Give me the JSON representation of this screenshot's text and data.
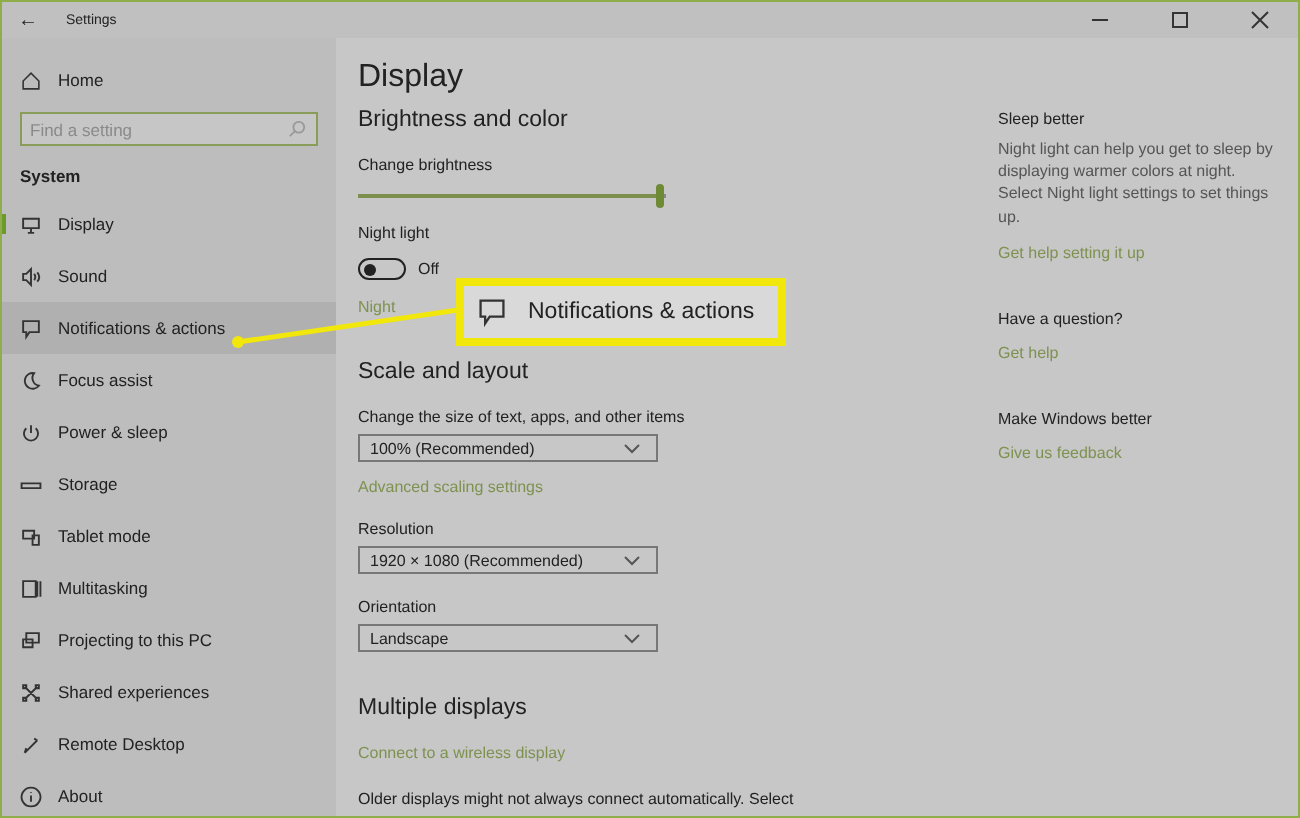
{
  "window": {
    "title": "Settings",
    "back": "←"
  },
  "sidebar": {
    "home": "Home",
    "search": {
      "placeholder": "Find a setting"
    },
    "section": "System",
    "items": [
      {
        "label": "Display",
        "selected": true,
        "highlighted": false
      },
      {
        "label": "Sound",
        "selected": false,
        "highlighted": false
      },
      {
        "label": "Notifications & actions",
        "selected": false,
        "highlighted": true
      },
      {
        "label": "Focus assist",
        "selected": false,
        "highlighted": false
      },
      {
        "label": "Power & sleep",
        "selected": false,
        "highlighted": false
      },
      {
        "label": "Storage",
        "selected": false,
        "highlighted": false
      },
      {
        "label": "Tablet mode",
        "selected": false,
        "highlighted": false
      },
      {
        "label": "Multitasking",
        "selected": false,
        "highlighted": false
      },
      {
        "label": "Projecting to this PC",
        "selected": false,
        "highlighted": false
      },
      {
        "label": "Shared experiences",
        "selected": false,
        "highlighted": false
      },
      {
        "label": "Remote Desktop",
        "selected": false,
        "highlighted": false
      },
      {
        "label": "About",
        "selected": false,
        "highlighted": false
      }
    ]
  },
  "main": {
    "title": "Display",
    "brightness_heading": "Brightness and color",
    "brightness": {
      "label": "Change brightness",
      "level": 0.98
    },
    "night_light": {
      "label": "Night light",
      "on": false,
      "state": "Off",
      "link": "Night"
    },
    "scale_heading": "Scale and layout",
    "dropdowns": [
      {
        "label": "Change the size of text, apps, and other items",
        "value": "100% (Recommended)",
        "link": "Advanced scaling settings"
      },
      {
        "label": "Resolution",
        "value": "1920 × 1080 (Recommended)"
      },
      {
        "label": "Orientation",
        "value": "Landscape"
      }
    ],
    "multiple_heading": "Multiple displays",
    "wireless_link": "Connect to a wireless display",
    "older_text": "Older displays might not always connect automatically. Select"
  },
  "aside": [
    {
      "heading": "Sleep better",
      "text": "Night light can help you get to sleep by displaying warmer colors at night. Select Night light settings to set things up.",
      "link": "Get help setting it up"
    },
    {
      "heading": "Have a question?",
      "link": "Get help"
    },
    {
      "heading": "Make Windows better",
      "link": "Give us feedback"
    }
  ],
  "callout": {
    "label": "Notifications & actions"
  }
}
